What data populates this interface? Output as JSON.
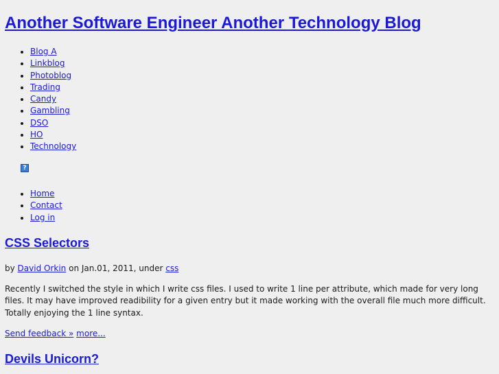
{
  "header": {
    "site_title": "Another Software Engineer Another Technology Blog"
  },
  "categories": [
    {
      "label": "Blog A"
    },
    {
      "label": "Linkblog"
    },
    {
      "label": "Photoblog"
    },
    {
      "label": "Trading"
    },
    {
      "label": "Candy"
    },
    {
      "label": "Gambling"
    },
    {
      "label": "DSO"
    },
    {
      "label": "HO"
    },
    {
      "label": "Technology"
    }
  ],
  "badge": {
    "glyph": "?",
    "icon": "question-mark-icon"
  },
  "meta_nav": [
    {
      "label": "Home"
    },
    {
      "label": "Contact"
    },
    {
      "label": "Log in"
    }
  ],
  "posts": [
    {
      "title": "CSS Selectors",
      "byline": {
        "by": "by",
        "author": "David Orkin",
        "on_date": "on Jan.01, 2011, under",
        "category": "css"
      },
      "body": "Recently I switched the style in which I write css files. I used to write 1 line per attribute, which made for very long files. It may have improved readibility for a given entry but it made working with the overall file much more difficult. Totally enjoying the 1 line syntax.",
      "feedback_label": "Send feedback »",
      "more_label": "more..."
    },
    {
      "title": "Devils Unicorn?"
    }
  ]
}
